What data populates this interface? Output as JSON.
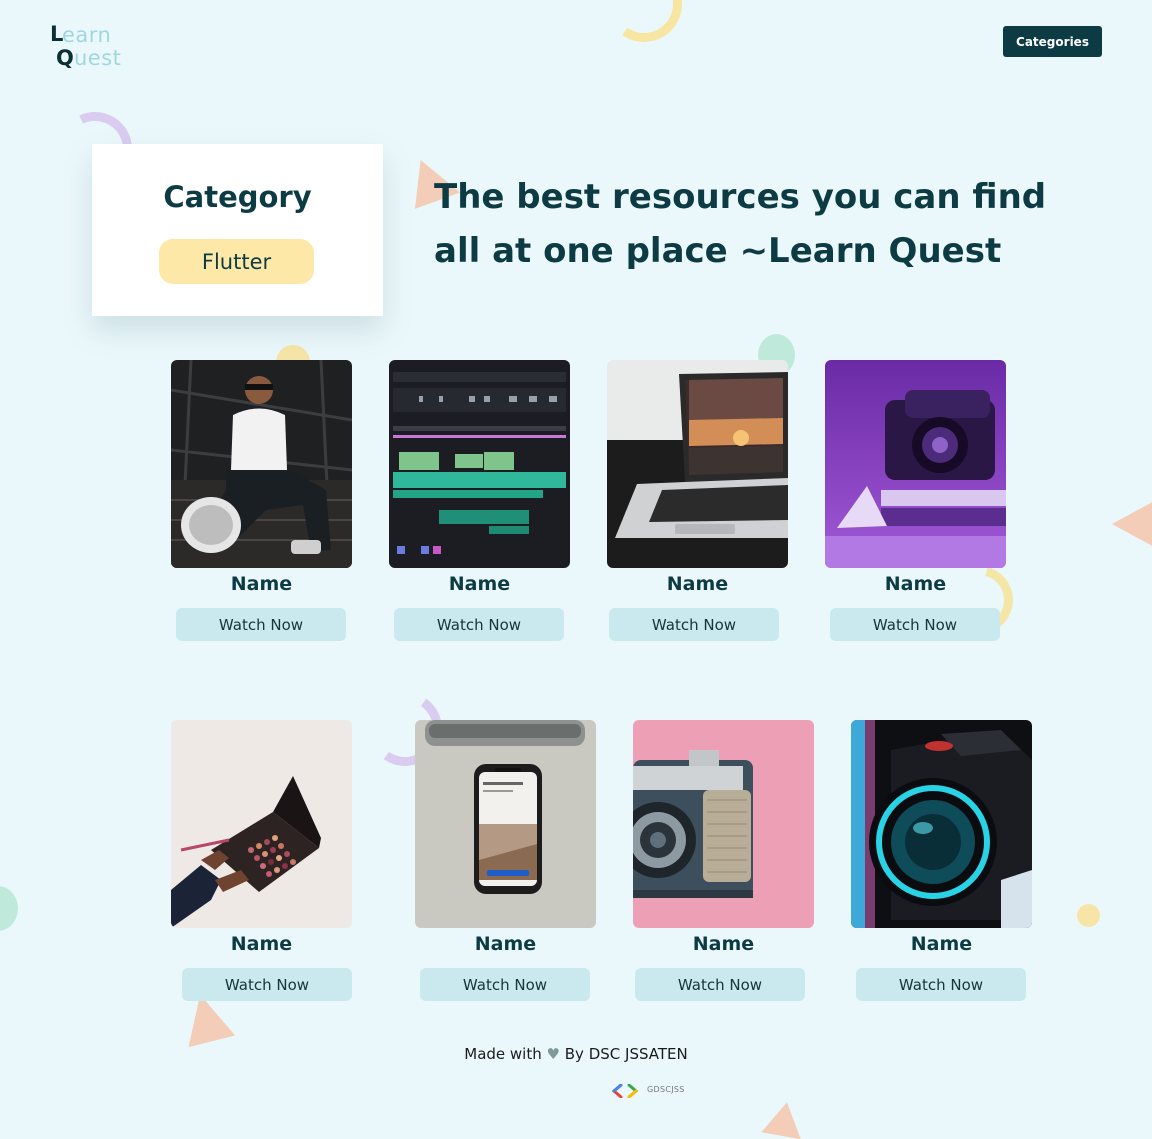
{
  "logo": {
    "first_letter": "L",
    "first_rest": "earn",
    "second_letter": "Q",
    "second_rest": "uest"
  },
  "nav": {
    "categories_label": "Categories"
  },
  "category_card": {
    "title": "Category",
    "selected": "Flutter"
  },
  "headline": {
    "line1": "The best resources you can find",
    "line2": "all at one place ~Learn Quest"
  },
  "resources": [
    {
      "name": "Name",
      "action": "Watch Now",
      "image": "man-sitting-on-stairs"
    },
    {
      "name": "Name",
      "action": "Watch Now",
      "image": "video-editing-timeline"
    },
    {
      "name": "Name",
      "action": "Watch Now",
      "image": "laptop-sparkler-screen"
    },
    {
      "name": "Name",
      "action": "Watch Now",
      "image": "purple-instant-camera"
    },
    {
      "name": "Name",
      "action": "Watch Now",
      "image": "hand-with-makeup-palette"
    },
    {
      "name": "Name",
      "action": "Watch Now",
      "image": "smartphone-on-desk"
    },
    {
      "name": "Name",
      "action": "Watch Now",
      "image": "vintage-camera-pink"
    },
    {
      "name": "Name",
      "action": "Watch Now",
      "image": "projector-blue-lens"
    }
  ],
  "footer": {
    "made_with": "Made with",
    "heart": "♥",
    "by": "By DSC JSSATEN",
    "gdsc_label": "GDSCJSS"
  },
  "colors": {
    "background": "#ebf8fb",
    "primary": "#0d3b44",
    "chip": "#fde8a8",
    "watch_button": "#c9e9ee"
  }
}
